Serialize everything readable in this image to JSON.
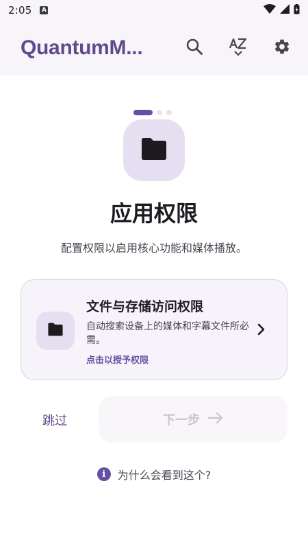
{
  "status_bar": {
    "time": "2:05",
    "notification_letter": "A"
  },
  "app_bar": {
    "title": "QuantumM...",
    "icons": [
      "search-icon",
      "sort-az-icon",
      "gear-icon"
    ]
  },
  "onboarding": {
    "page_indicator": {
      "total": 3,
      "current": 1
    },
    "title": "应用权限",
    "subtitle": "配置权限以启用核心功能和媒体播放。",
    "permission_card": {
      "title": "文件与存储访问权限",
      "description": "自动搜索设备上的媒体和字幕文件所必需。",
      "action": "点击以授予权限"
    },
    "skip_label": "跳过",
    "next_label": "下一步",
    "why_label": "为什么会看到这个?"
  },
  "colors": {
    "accent": "#6750a4",
    "title": "#5f4b8b",
    "surface": "#f8f5fa",
    "icon_container": "#e6dff1",
    "disabled_text": "#c9c6cc"
  }
}
